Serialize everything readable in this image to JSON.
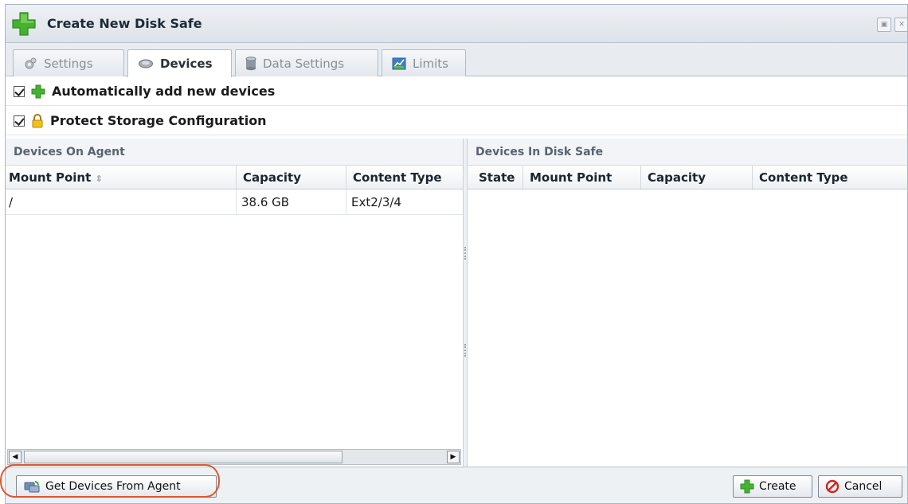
{
  "dialog": {
    "title": "Create New Disk Safe"
  },
  "tabs": [
    {
      "label": "Settings",
      "icon": "gear-icon",
      "active": false
    },
    {
      "label": "Devices",
      "icon": "disk-icon",
      "active": true
    },
    {
      "label": "Data Settings",
      "icon": "database-icon",
      "active": false
    },
    {
      "label": "Limits",
      "icon": "chart-icon",
      "active": false
    }
  ],
  "options": {
    "auto_add": {
      "label": "Automatically add new devices",
      "checked": true,
      "icon": "plus-icon"
    },
    "protect_storage": {
      "label": "Protect Storage Configuration",
      "checked": true,
      "icon": "lock-icon"
    }
  },
  "agent_panel": {
    "title": "Devices On Agent",
    "columns": [
      "Mount Point",
      "Capacity",
      "Content Type"
    ],
    "rows": [
      {
        "mount_point": "/",
        "capacity": "38.6 GB",
        "content_type": "Ext2/3/4"
      }
    ]
  },
  "safe_panel": {
    "title": "Devices In Disk Safe",
    "columns": [
      "State",
      "Mount Point",
      "Capacity",
      "Content Type"
    ],
    "rows": []
  },
  "footer": {
    "get_devices_label": "Get Devices From Agent",
    "create_label": "Create",
    "cancel_label": "Cancel"
  },
  "colors": {
    "accent_green": "#3fae2a",
    "cancel_red": "#d0231b",
    "highlight": "#e0552d"
  }
}
